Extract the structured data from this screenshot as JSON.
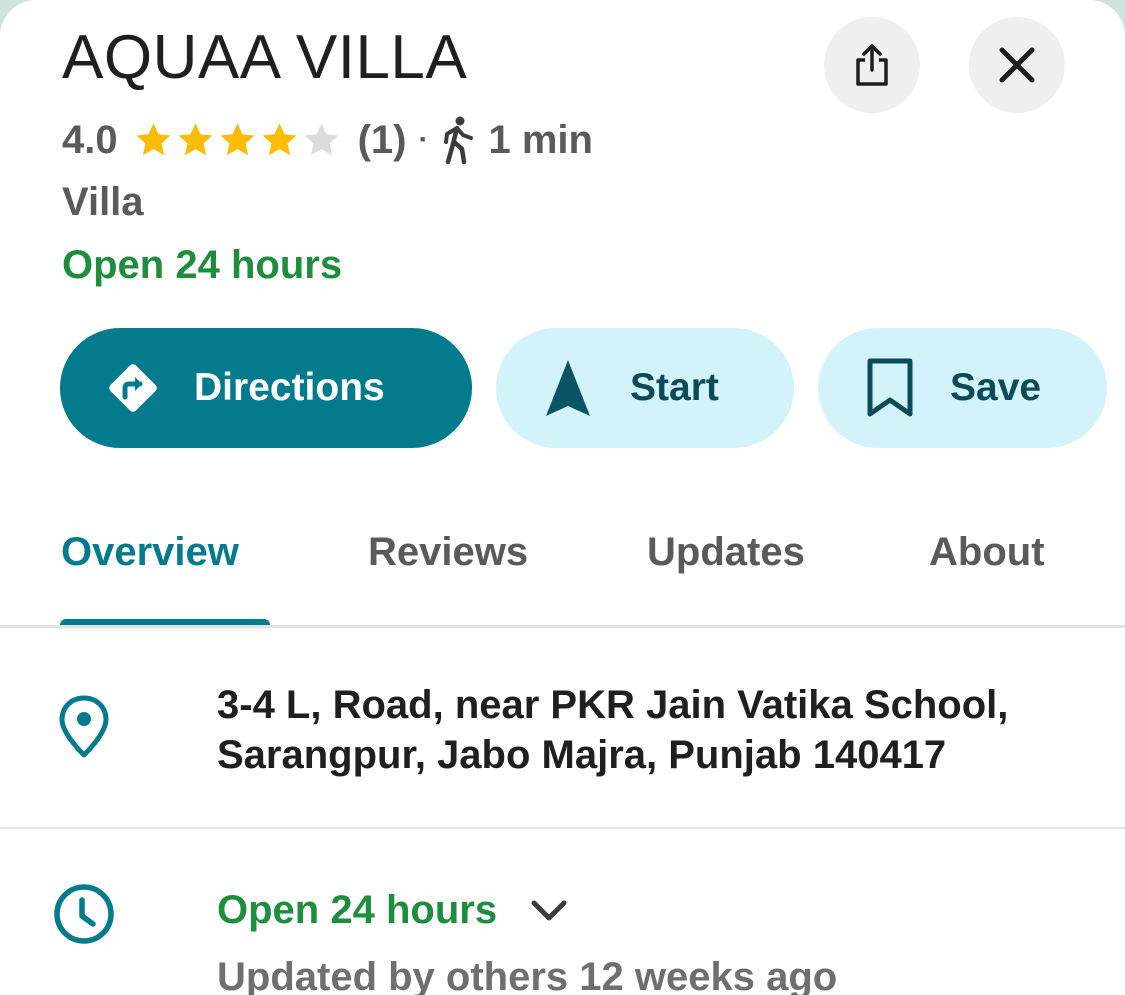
{
  "place": {
    "name": "AQUAA VILLA",
    "rating": "4.0",
    "rating_stars": 4,
    "review_count": "(1)",
    "separator": "·",
    "walk_time": "1 min",
    "category": "Villa",
    "open_status": "Open 24 hours"
  },
  "header": {
    "share_icon": "share-icon",
    "close_icon": "close-icon"
  },
  "actions": {
    "directions_label": "Directions",
    "start_label": "Start",
    "save_label": "Save"
  },
  "tabs": [
    {
      "label": "Overview",
      "active": true
    },
    {
      "label": "Reviews",
      "active": false
    },
    {
      "label": "Updates",
      "active": false
    },
    {
      "label": "About",
      "active": false
    }
  ],
  "details": {
    "address_line1": "3-4 L, Road, near PKR Jain Vatika School,",
    "address_line2": "Sarangpur, Jabo Majra, Punjab 140417",
    "hours_label": "Open 24 hours",
    "hours_updated": "Updated by others 12 weeks ago"
  },
  "colors": {
    "accent": "#027b8c",
    "open_green": "#1e8e3e",
    "star_gold": "#fbbc04",
    "star_empty": "#dadce0",
    "tonal_button": "#d3f3fb"
  }
}
